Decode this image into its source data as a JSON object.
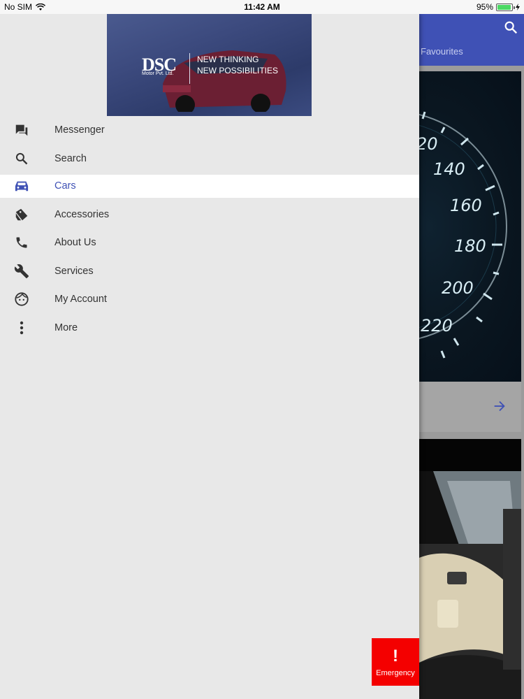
{
  "status_bar": {
    "carrier": "No SIM",
    "time": "11:42 AM",
    "battery": "95%",
    "battery_level": 0.95
  },
  "banner": {
    "brand": "DSC",
    "brand_sub": "Motor Pvt. Ltd.",
    "tagline_1": "NEW THINKING",
    "tagline_2": "NEW POSSIBILITIES"
  },
  "menu": {
    "items": [
      {
        "label": "Messenger",
        "icon": "chat-icon"
      },
      {
        "label": "Search",
        "icon": "search-icon"
      },
      {
        "label": "Cars",
        "icon": "car-icon",
        "active": true
      },
      {
        "label": "Accessories",
        "icon": "tag-icon"
      },
      {
        "label": "About Us",
        "icon": "phone-icon"
      },
      {
        "label": "Services",
        "icon": "wrench-icon"
      },
      {
        "label": "My Account",
        "icon": "face-icon"
      },
      {
        "label": "More",
        "icon": "more-vert-icon"
      }
    ]
  },
  "background_app": {
    "tab_label": "Favourites",
    "speedo_ticks": [
      "20",
      "140",
      "160",
      "180",
      "200",
      "220"
    ]
  },
  "emergency": {
    "label": "Emergency"
  },
  "colors": {
    "primary": "#3f51b5",
    "emergency": "#f40000",
    "drawer_bg": "#e8e8e8"
  }
}
